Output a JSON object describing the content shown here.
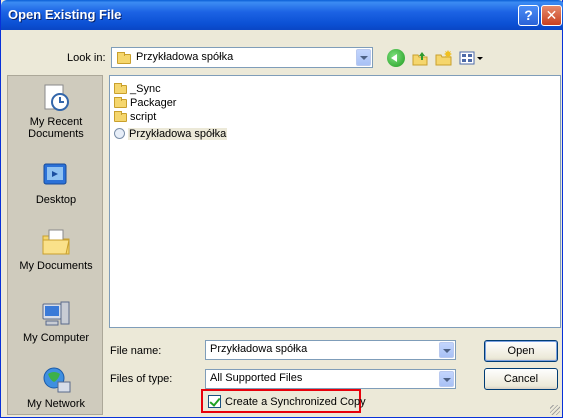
{
  "window": {
    "title": "Open Existing File"
  },
  "lookin": {
    "label": "Look in:",
    "value": "Przykładowa spółka"
  },
  "places": [
    {
      "label_line1": "My Recent",
      "label_line2": "Documents"
    },
    {
      "label_line1": "Desktop",
      "label_line2": ""
    },
    {
      "label_line1": "My Documents",
      "label_line2": ""
    },
    {
      "label_line1": "My Computer",
      "label_line2": ""
    },
    {
      "label_line1": "My Network",
      "label_line2": ""
    }
  ],
  "files": [
    {
      "name": "_Sync",
      "type": "folder"
    },
    {
      "name": "Packager",
      "type": "folder"
    },
    {
      "name": "script",
      "type": "folder"
    },
    {
      "name": "Przykładowa spółka",
      "type": "document",
      "selected": true
    }
  ],
  "filename": {
    "label": "File name:",
    "value": "Przykładowa spółka"
  },
  "filetype": {
    "label": "Files of type:",
    "value": "All Supported Files"
  },
  "buttons": {
    "open": "Open",
    "cancel": "Cancel"
  },
  "sync": {
    "label": "Create a Synchronized Copy",
    "checked": true
  },
  "colors": {
    "titlebar": "#0a5fd6",
    "highlight_border": "#e8000b",
    "dialog_bg": "#ece9d8"
  },
  "icons": {
    "back": "back-arrow-icon",
    "up": "up-folder-icon",
    "new_folder": "new-folder-icon",
    "view": "view-menu-icon"
  }
}
